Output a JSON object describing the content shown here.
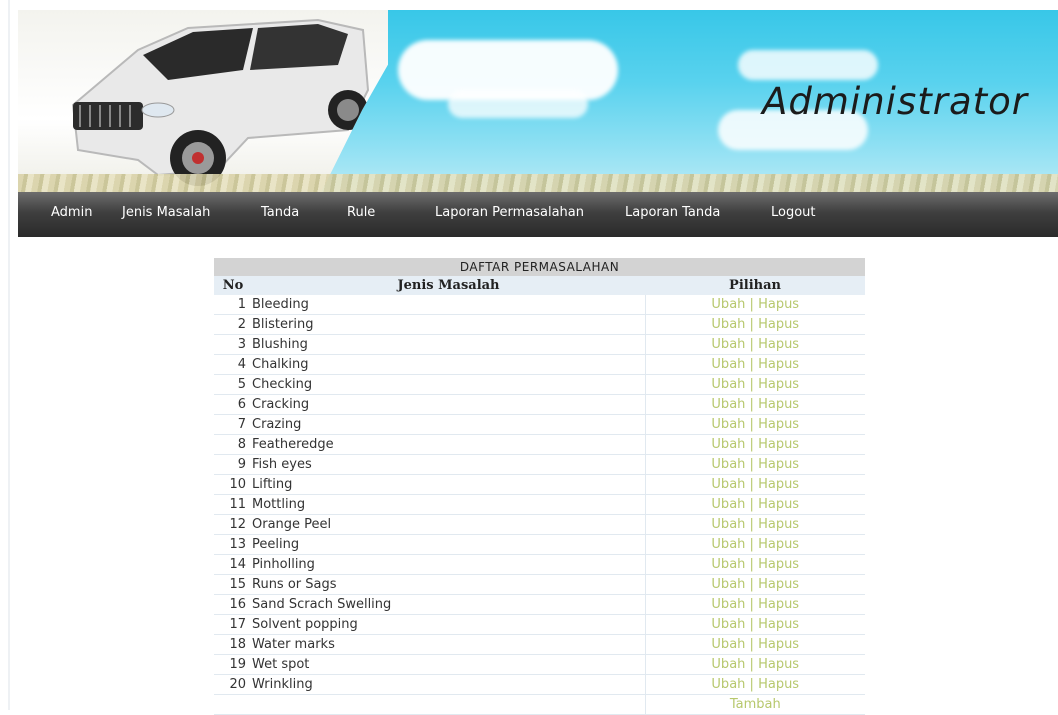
{
  "header": {
    "title": "Administrator"
  },
  "nav": {
    "items": [
      {
        "label": "Admin"
      },
      {
        "label": "Jenis Masalah"
      },
      {
        "label": "Tanda"
      },
      {
        "label": "Rule"
      },
      {
        "label": "Laporan Permasalahan"
      },
      {
        "label": "Laporan Tanda"
      },
      {
        "label": "Logout"
      }
    ]
  },
  "table": {
    "caption": "DAFTAR PERMASALAHAN",
    "columns": [
      "No",
      "Jenis Masalah",
      "Pilihan"
    ],
    "action_edit": "Ubah",
    "action_separator": "|",
    "action_delete": "Hapus",
    "rows": [
      {
        "no": "1",
        "name": "Bleeding"
      },
      {
        "no": "2",
        "name": "Blistering"
      },
      {
        "no": "3",
        "name": "Blushing"
      },
      {
        "no": "4",
        "name": "Chalking"
      },
      {
        "no": "5",
        "name": "Checking"
      },
      {
        "no": "6",
        "name": "Cracking"
      },
      {
        "no": "7",
        "name": "Crazing"
      },
      {
        "no": "8",
        "name": "Featheredge"
      },
      {
        "no": "9",
        "name": "Fish eyes"
      },
      {
        "no": "10",
        "name": "Lifting"
      },
      {
        "no": "11",
        "name": "Mottling"
      },
      {
        "no": "12",
        "name": "Orange Peel"
      },
      {
        "no": "13",
        "name": "Peeling"
      },
      {
        "no": "14",
        "name": "Pinholling"
      },
      {
        "no": "15",
        "name": "Runs or Sags"
      },
      {
        "no": "16",
        "name": "Sand Scrach Swelling"
      },
      {
        "no": "17",
        "name": "Solvent popping"
      },
      {
        "no": "18",
        "name": "Water marks"
      },
      {
        "no": "19",
        "name": "Wet spot"
      },
      {
        "no": "20",
        "name": "Wrinkling"
      }
    ],
    "add_label": "Tambah"
  },
  "colors": {
    "nav_bg": "#3a3a3a",
    "link": "#b7c86d",
    "header_sky": "#45cbeb"
  }
}
